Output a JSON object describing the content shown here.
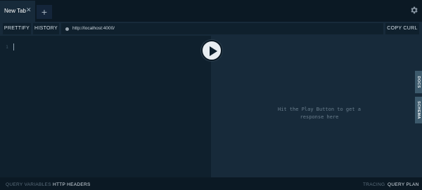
{
  "tabs": [
    {
      "label": "New Tab",
      "close": "✕"
    }
  ],
  "add_tab_label": "+",
  "toolbar": {
    "prettify_label": "PRETTIFY",
    "history_label": "HISTORY",
    "endpoint_url": "http://localhost:4000/",
    "copy_curl_label": "COPY CURL"
  },
  "editor": {
    "line_number": "1"
  },
  "result": {
    "placeholder": "Hit the Play Button to get a response here"
  },
  "side_tabs": {
    "docs_label": "DOCS",
    "schema_label": "SCHEMA"
  },
  "bottom_bar": {
    "query_variables_label": "QUERY VARIABLES",
    "http_headers_label": "HTTP HEADERS",
    "tracing_label": "TRACING",
    "query_plan_label": "QUERY PLAN"
  },
  "icons": {
    "settings": "gear-icon",
    "play": "play-icon",
    "url_status": "status-dot-icon"
  },
  "colors": {
    "background": "#0f202d",
    "panel": "#172a3a",
    "tabbar": "#0b1924",
    "side_tab": "#3d5a6c",
    "play_button": "#e8edf1"
  }
}
